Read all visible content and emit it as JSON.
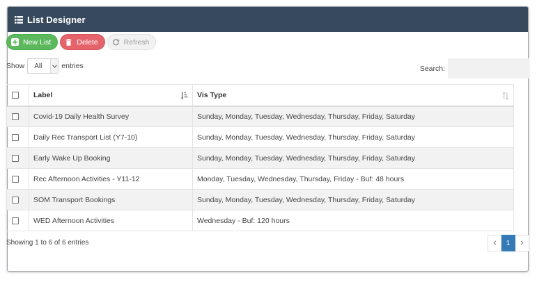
{
  "panel": {
    "title": "List Designer",
    "header_bg": "#36495d"
  },
  "toolbar": {
    "new_label": "New List",
    "delete_label": "Delete",
    "refresh_label": "Refresh"
  },
  "length": {
    "show_label": "Show",
    "selected": "All",
    "entries_label": "entries"
  },
  "search": {
    "label": "Search:",
    "value": ""
  },
  "table": {
    "columns": [
      {
        "label": "Label"
      },
      {
        "label": "Vis Type"
      }
    ],
    "rows": [
      {
        "label": "Covid-19 Daily Health Survey",
        "vis_type": "Sunday, Monday, Tuesday, Wednesday, Thursday, Friday, Saturday"
      },
      {
        "label": "Daily Rec Transport List (Y7-10)",
        "vis_type": "Sunday, Monday, Tuesday, Wednesday, Thursday, Friday, Saturday"
      },
      {
        "label": "Early Wake Up Booking",
        "vis_type": "Sunday, Monday, Tuesday, Wednesday, Thursday, Friday, Saturday"
      },
      {
        "label": "Rec Afternoon Activities - Y11-12",
        "vis_type": "Monday, Tuesday, Wednesday, Thursday, Friday - Buf: 48 hours"
      },
      {
        "label": "SOM Transport Bookings",
        "vis_type": "Sunday, Monday, Tuesday, Wednesday, Thursday, Friday, Saturday"
      },
      {
        "label": "WED Afternoon Activities",
        "vis_type": "Wednesday - Buf: 120 hours"
      }
    ]
  },
  "footer": {
    "info": "Showing 1 to 6 of 6 entries",
    "prev_icon": "chevron-left-icon",
    "page": "1",
    "next_icon": "chevron-right-icon"
  },
  "colors": {
    "accent_green": "#5cb85c",
    "accent_red": "#e5646c",
    "page_active": "#337ab7"
  }
}
